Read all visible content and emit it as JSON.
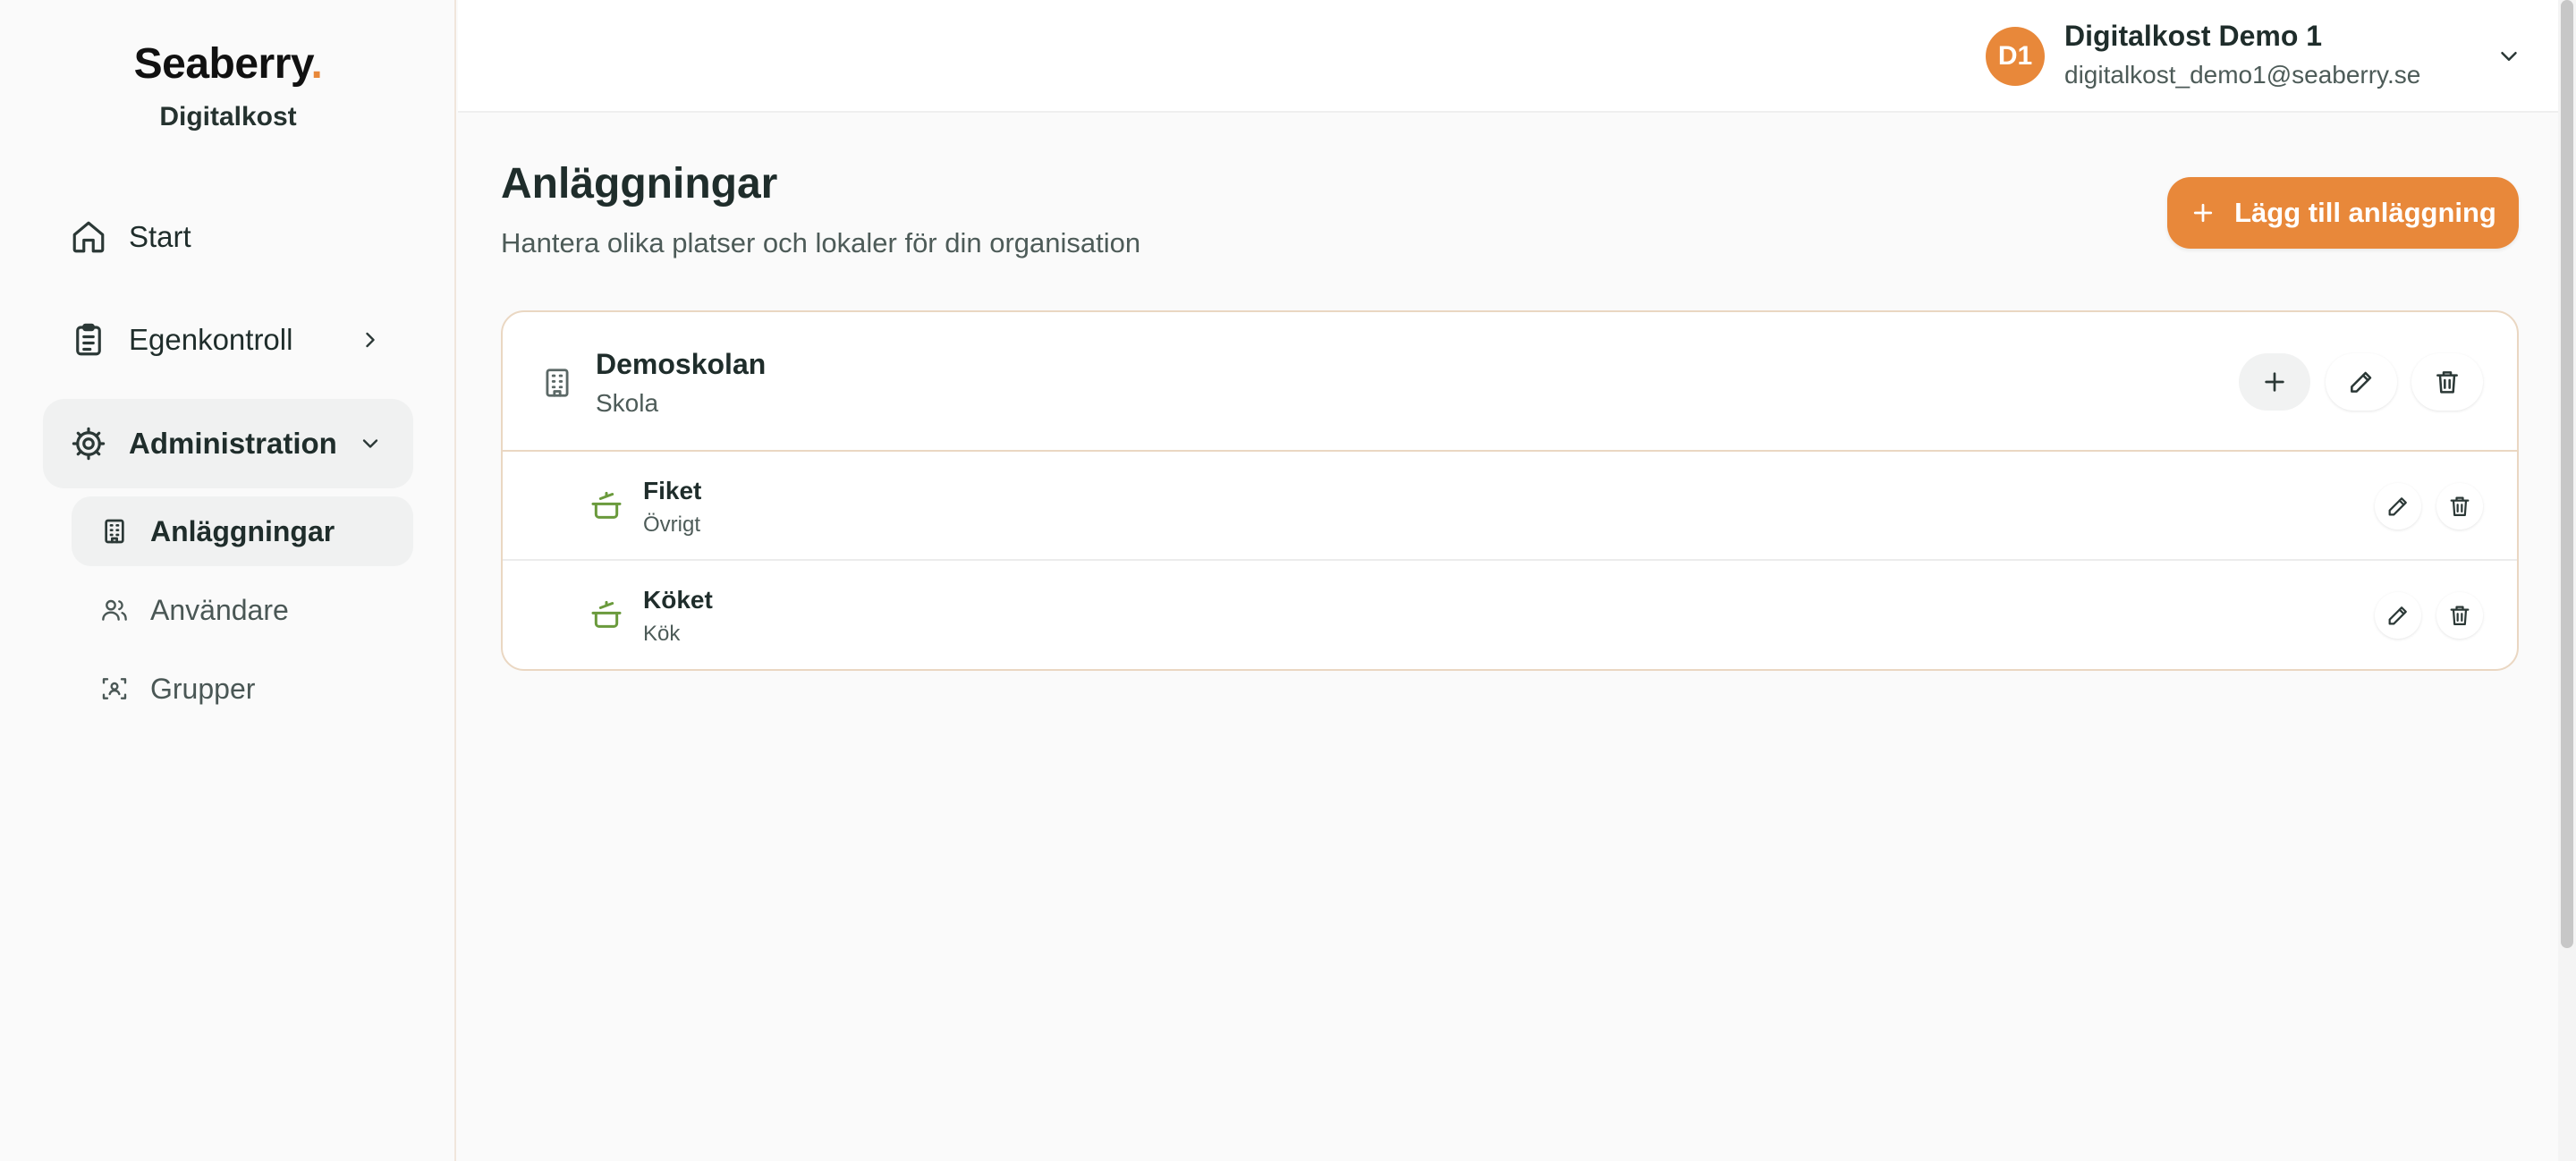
{
  "brand": {
    "logo": "Seaberry",
    "logo_dot": ".",
    "subtitle": "Digitalkost"
  },
  "sidebar": {
    "items": [
      {
        "label": "Start",
        "icon": "home-icon"
      },
      {
        "label": "Egenkontroll",
        "icon": "clipboard-icon"
      },
      {
        "label": "Administration",
        "icon": "gear-icon"
      }
    ],
    "subitems": [
      {
        "label": "Anläggningar",
        "icon": "building-icon"
      },
      {
        "label": "Användare",
        "icon": "users-icon"
      },
      {
        "label": "Grupper",
        "icon": "group-icon"
      }
    ]
  },
  "user": {
    "initials": "D1",
    "name": "Digitalkost Demo 1",
    "email": "digitalkost_demo1@seaberry.se"
  },
  "page": {
    "title": "Anläggningar",
    "subtitle": "Hantera olika platser och lokaler för din organisation",
    "add_button": "Lägg till anläggning"
  },
  "facility": {
    "name": "Demoskolan",
    "type": "Skola",
    "children": [
      {
        "name": "Fiket",
        "type": "Övrigt"
      },
      {
        "name": "Köket",
        "type": "Kök"
      }
    ]
  },
  "colors": {
    "accent": "#e8883a",
    "card_border": "#ead7c2",
    "child_icon": "#6a9a3c"
  }
}
